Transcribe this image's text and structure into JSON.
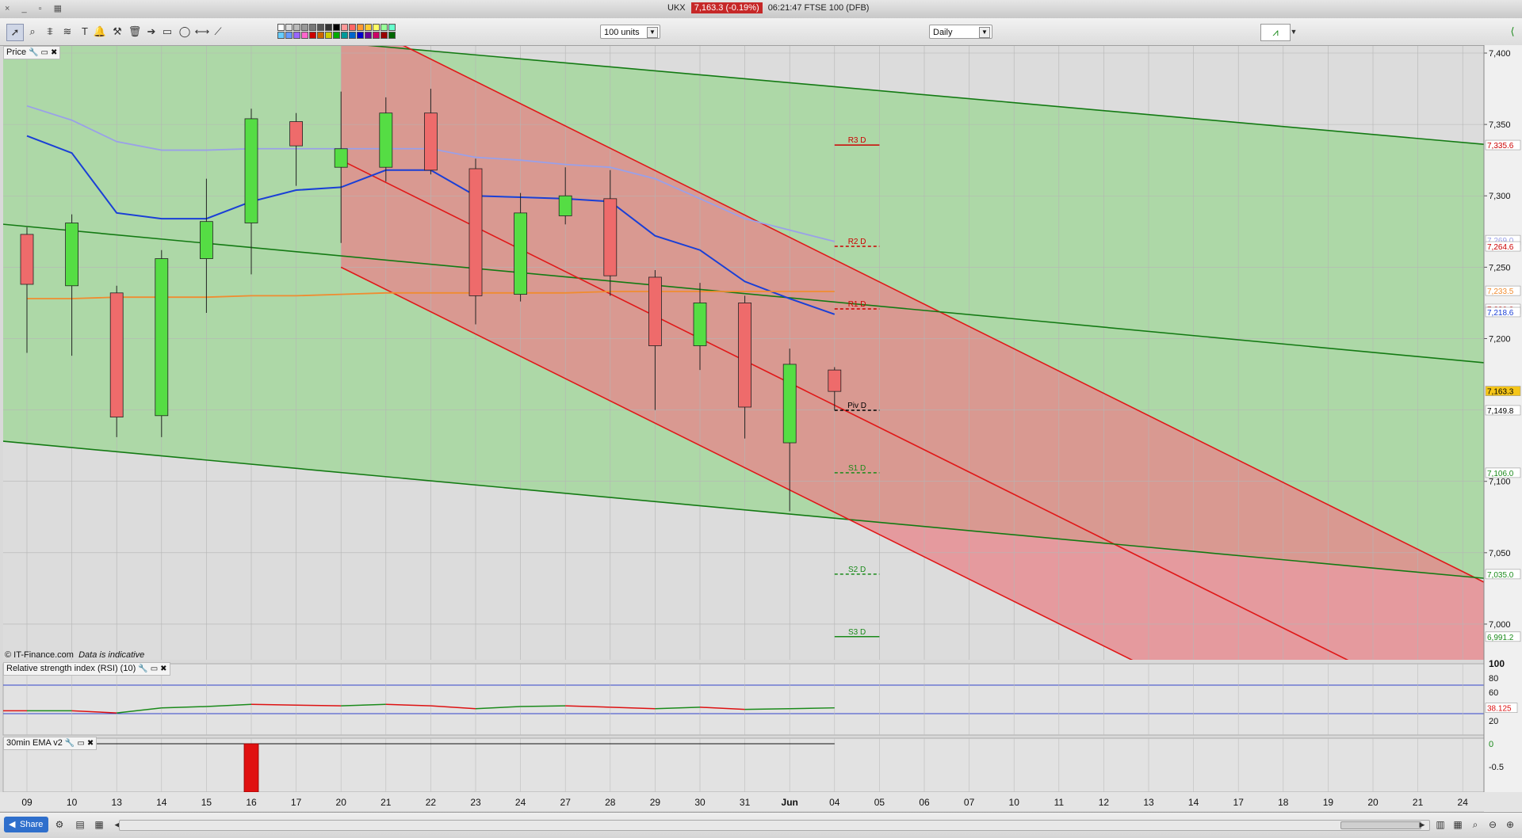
{
  "window": {
    "symbol": "UKX",
    "price_badge": "7,163.3 (-0.19%)",
    "title": "06:21:47 FTSE 100 (DFB)"
  },
  "toolbar": {
    "units_select": "100 units",
    "period_select": "Daily",
    "drawing_tools": [
      "pointer-icon",
      "zoom-icon",
      "fibonacci-icon",
      "text-icon",
      "fib-fan-icon",
      "alert-bell-icon",
      "hammer-icon",
      "trash-icon",
      "arrow-icon",
      "rectangle-icon",
      "ellipse-icon",
      "horizontal-line-icon",
      "trend-line-icon"
    ],
    "colors": [
      "#ffffff",
      "#dddddd",
      "#bbbbbb",
      "#999999",
      "#777777",
      "#555555",
      "#333333",
      "#000000",
      "#ff9999",
      "#ff6666",
      "#ff9933",
      "#ffcc33",
      "#ffff66",
      "#99ff99",
      "#66ffcc",
      "#66ccff",
      "#6699ff",
      "#9966ff",
      "#ff66cc",
      "#cc0000",
      "#cc6600",
      "#cccc00",
      "#00aa00",
      "#009999",
      "#0066cc",
      "#0000cc",
      "#660099",
      "#cc0066",
      "#990000",
      "#006600"
    ]
  },
  "panels": {
    "price_label": "Price",
    "rsi_label": "Relative strength index (RSI) (10)",
    "ema_label": "30min EMA v2",
    "credit": "© IT-Finance.com",
    "credit_note": "Data is indicative"
  },
  "chart_data": [
    {
      "type": "candlestick",
      "title": "Price",
      "x": [
        "09",
        "10",
        "13",
        "14",
        "15",
        "16",
        "17",
        "20",
        "21",
        "22",
        "23",
        "24",
        "27",
        "28",
        "29",
        "30",
        "31",
        "Jun",
        "04"
      ],
      "ohlc": [
        [
          7273,
          7278,
          7190,
          7238
        ],
        [
          7237,
          7287,
          7188,
          7281
        ],
        [
          7232,
          7237,
          7131,
          7145
        ],
        [
          7146,
          7262,
          7131,
          7256
        ],
        [
          7256,
          7312,
          7218,
          7282
        ],
        [
          7281,
          7361,
          7245,
          7354
        ],
        [
          7352,
          7358,
          7307,
          7335
        ],
        [
          7320,
          7373,
          7267,
          7333
        ],
        [
          7320,
          7369,
          7310,
          7358
        ],
        [
          7358,
          7375,
          7315,
          7318
        ],
        [
          7319,
          7326,
          7210,
          7230
        ],
        [
          7231,
          7302,
          7226,
          7288
        ],
        [
          7286,
          7320,
          7280,
          7300
        ],
        [
          7298,
          7318,
          7230,
          7244
        ],
        [
          7243,
          7248,
          7150,
          7195
        ],
        [
          7195,
          7239,
          7178,
          7225
        ],
        [
          7225,
          7230,
          7130,
          7152
        ],
        [
          7127,
          7193,
          7079,
          7182
        ],
        [
          7178,
          7180,
          7150,
          7163
        ]
      ],
      "future_x": [
        "05",
        "06",
        "07",
        "10",
        "11",
        "12",
        "13",
        "14",
        "17",
        "18",
        "19",
        "20",
        "21",
        "24"
      ],
      "ylim": [
        6975,
        7405
      ],
      "yticks": [
        7000,
        7050,
        7100,
        7150,
        7200,
        7250,
        7300,
        7350,
        7400
      ],
      "ytick_labels": [
        "7,000",
        "7,050",
        "7,100",
        "",
        "7,200",
        "7,250",
        "7,300",
        "7,350",
        "7,400"
      ],
      "moving_averages": [
        {
          "color": "#1a3fd6",
          "values": [
            7342,
            7330,
            7288,
            7284,
            7284,
            7296,
            7304,
            7306,
            7318,
            7318,
            7300,
            7299,
            7298,
            7296,
            7272,
            7262,
            7240,
            7228,
            7217
          ]
        },
        {
          "color": "#9aa0e8",
          "values": [
            7363,
            7353,
            7338,
            7332,
            7332,
            7333,
            7333,
            7333,
            7333,
            7333,
            7327,
            7325,
            7322,
            7320,
            7312,
            7298,
            7284,
            7276,
            7268
          ]
        },
        {
          "color": "#f08c30",
          "values": [
            7228,
            7228,
            7229,
            7229,
            7229,
            7230,
            7230,
            7231,
            7232,
            7232,
            7232,
            7232,
            7232,
            7233,
            7233,
            7233,
            7233,
            7233,
            7233
          ]
        }
      ],
      "pivots": [
        {
          "label": "R3 D",
          "value": 7335.6,
          "color": "#cc0000",
          "dashed": false
        },
        {
          "label": "R2 D",
          "value": 7264.6,
          "color": "#cc0000",
          "dashed": true
        },
        {
          "label": "R1 D",
          "value": 7220.8,
          "color": "#cc0000",
          "dashed": true
        },
        {
          "label": "Piv D",
          "value": 7149.8,
          "color": "#000000",
          "dashed": true
        },
        {
          "label": "S1 D",
          "value": 7106.0,
          "color": "#1a8a1a",
          "dashed": true
        },
        {
          "label": "S2 D",
          "value": 7035.0,
          "color": "#1a8a1a",
          "dashed": true
        },
        {
          "label": "S3 D",
          "value": 6991.2,
          "color": "#1a8a1a",
          "dashed": false
        }
      ],
      "right_tags": [
        {
          "text": "7,335.6",
          "color": "#cc0000",
          "value": 7335.6
        },
        {
          "text": "7,269.0",
          "color": "#9aa0e8",
          "value": 7269.0
        },
        {
          "text": "7,264.6",
          "color": "#cc0000",
          "value": 7264.6
        },
        {
          "text": "7,233.5",
          "color": "#f08c30",
          "value": 7233.5
        },
        {
          "text": "7,220.8",
          "color": "#cc0000",
          "value": 7220.8
        },
        {
          "text": "7,218.6",
          "color": "#1a3fd6",
          "value": 7218.6
        },
        {
          "text": "7,163.3",
          "color": "#000000",
          "value": 7163.3,
          "highlight": true
        },
        {
          "text": "7,149.8",
          "color": "#000000",
          "value": 7149.8
        },
        {
          "text": "7,106.0",
          "color": "#1a8a1a",
          "value": 7106.0
        },
        {
          "text": "7,035.0",
          "color": "#1a8a1a",
          "value": 7035.0
        },
        {
          "text": "6,991.2",
          "color": "#1a8a1a",
          "value": 6991.2
        }
      ],
      "green_channel": {
        "upper": [
          [
            -0.5,
            7428
          ],
          [
            32.5,
            7336
          ]
        ],
        "middle": [
          [
            -0.5,
            7280
          ],
          [
            32.5,
            7183
          ]
        ],
        "lower": [
          [
            -0.5,
            7128
          ],
          [
            32.5,
            7032
          ]
        ]
      },
      "red_channel": {
        "upper": [
          [
            7,
            7427
          ],
          [
            32.5,
            7029
          ]
        ],
        "middle": [
          [
            7,
            7325
          ],
          [
            32.5,
            6927
          ]
        ],
        "lower": [
          [
            7,
            7250
          ],
          [
            32.5,
            6852
          ]
        ]
      }
    },
    {
      "type": "line",
      "title": "Relative strength index (RSI) (10)",
      "x": [
        "09",
        "10",
        "13",
        "14",
        "15",
        "16",
        "17",
        "20",
        "21",
        "22",
        "23",
        "24",
        "27",
        "28",
        "29",
        "30",
        "31",
        "Jun",
        "04"
      ],
      "values": [
        34,
        34,
        31,
        38,
        40,
        43,
        42,
        41,
        43,
        41,
        37,
        40,
        41,
        39,
        37,
        39,
        36,
        37,
        38.125
      ],
      "ylim": [
        0,
        100
      ],
      "levels": [
        70,
        30
      ],
      "yticks": [
        100,
        80,
        60,
        40,
        20
      ],
      "last_label": "38.125",
      "up_color": "#1a8a1a",
      "down_color": "#dd1111"
    },
    {
      "type": "bar",
      "title": "30min EMA v2",
      "x": [
        "16"
      ],
      "values": [
        -1.2
      ],
      "ylim": [
        -1.05,
        0.12
      ],
      "yticks": [
        0,
        -0.5
      ],
      "ytick_labels": [
        "0",
        "-0.5"
      ]
    }
  ],
  "status": {
    "share_label": "Share"
  }
}
